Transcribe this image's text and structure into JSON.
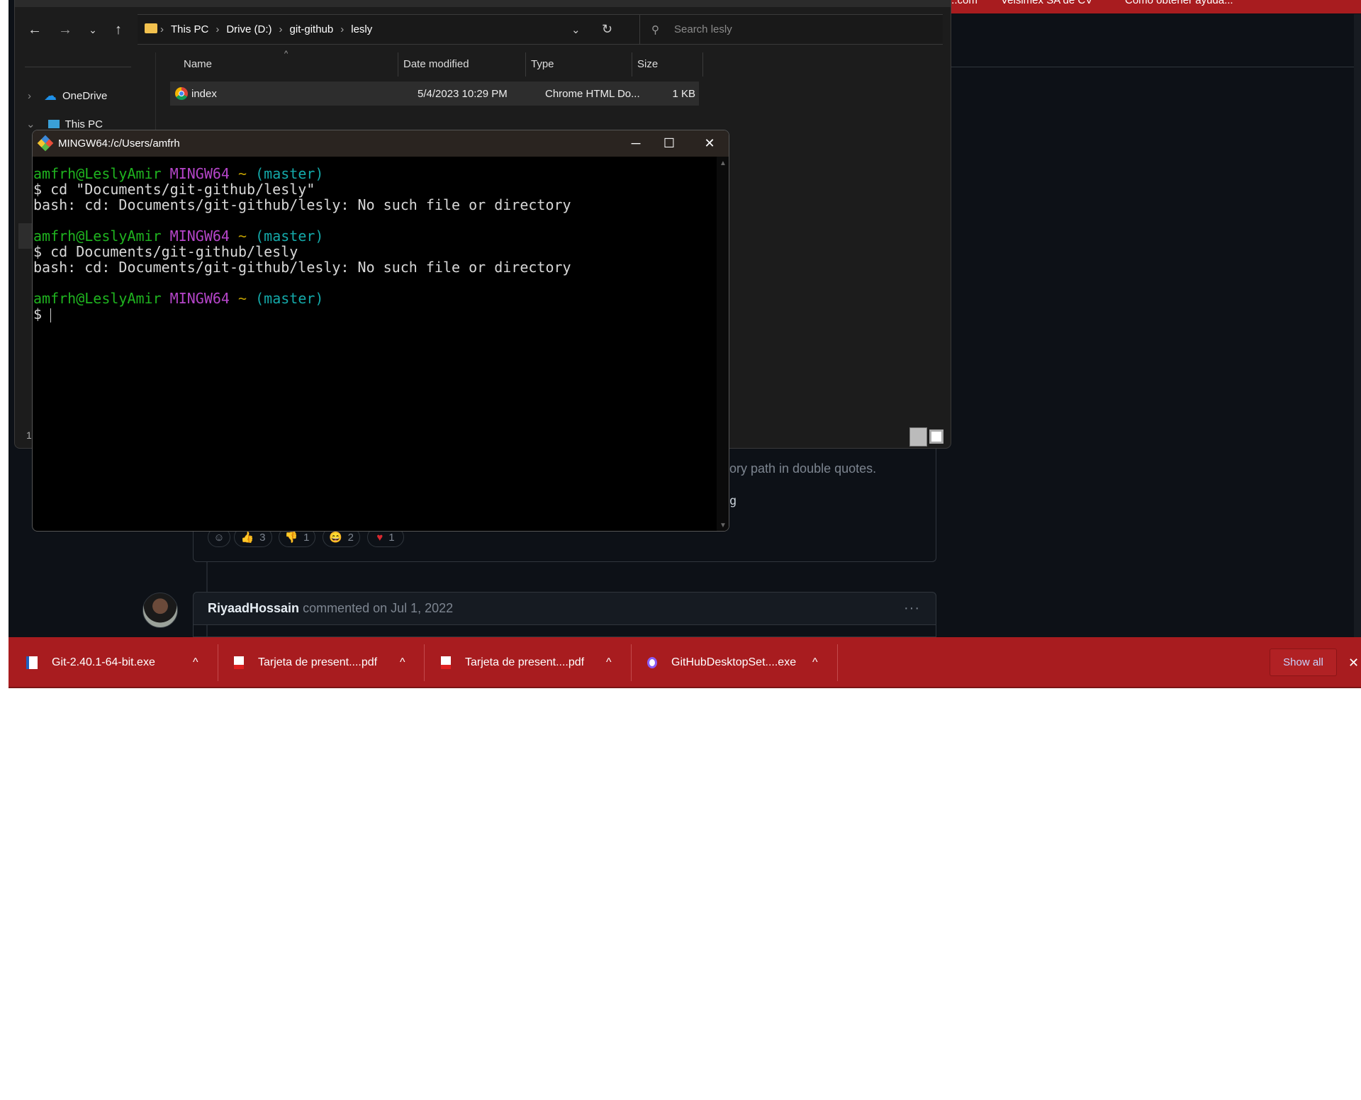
{
  "browser": {
    "bookmarks": [
      "...com",
      "Velsimex SA de CV",
      "Como obtener ayuda..."
    ]
  },
  "github": {
    "partial_text_1": "ory path in double quotes.",
    "partial_text_2": "g",
    "reactions": [
      {
        "icon": "smiley-icon",
        "count": ""
      },
      {
        "icon": "thumbs-up-icon",
        "count": "3"
      },
      {
        "icon": "thumbs-down-icon",
        "count": "1"
      },
      {
        "icon": "laugh-icon",
        "count": "2"
      },
      {
        "icon": "heart-icon",
        "count": "1"
      }
    ],
    "comment": {
      "author": "RiyaadHossain",
      "meta": "commented on Jul 1, 2022",
      "menu": "···"
    }
  },
  "explorer": {
    "breadcrumb": [
      "This PC",
      "Drive (D:)",
      "git-github",
      "lesly"
    ],
    "search_placeholder": "Search lesly",
    "columns": [
      "Name",
      "Date modified",
      "Type",
      "Size"
    ],
    "files": [
      {
        "name": "index",
        "date": "5/4/2023 10:29 PM",
        "type": "Chrome HTML Do...",
        "size": "1 KB"
      }
    ],
    "sidebar": [
      "OneDrive",
      "This PC"
    ],
    "status": "1"
  },
  "terminal": {
    "title": "MINGW64:/c/Users/amfrh",
    "prompt": {
      "user": "amfrh@LeslyAmir",
      "sys": "MINGW64",
      "tilde": "~",
      "branch": "(master)"
    },
    "cmd1": "$ cd \"Documents/git-github/lesly\"",
    "err1": "bash: cd: Documents/git-github/lesly: No such file or directory",
    "cmd2": "$ cd Documents/git-github/lesly",
    "err2": "bash: cd: Documents/git-github/lesly: No such file or directory",
    "cmd3": "$ "
  },
  "downloads": {
    "items": [
      {
        "name": "Git-2.40.1-64-bit.exe",
        "icon": "installer-icon"
      },
      {
        "name": "Tarjeta de present....pdf",
        "icon": "pdf-icon"
      },
      {
        "name": "Tarjeta de present....pdf",
        "icon": "pdf-icon"
      },
      {
        "name": "GitHubDesktopSet....exe",
        "icon": "github-desktop-icon"
      }
    ],
    "show_all": "Show all"
  },
  "colors": {
    "download_bar": "#a81c1f",
    "page_bg": "#0d1117",
    "terminal_green": "#1fb31f",
    "terminal_magenta": "#b545c9",
    "terminal_cyan": "#14a9a9"
  }
}
